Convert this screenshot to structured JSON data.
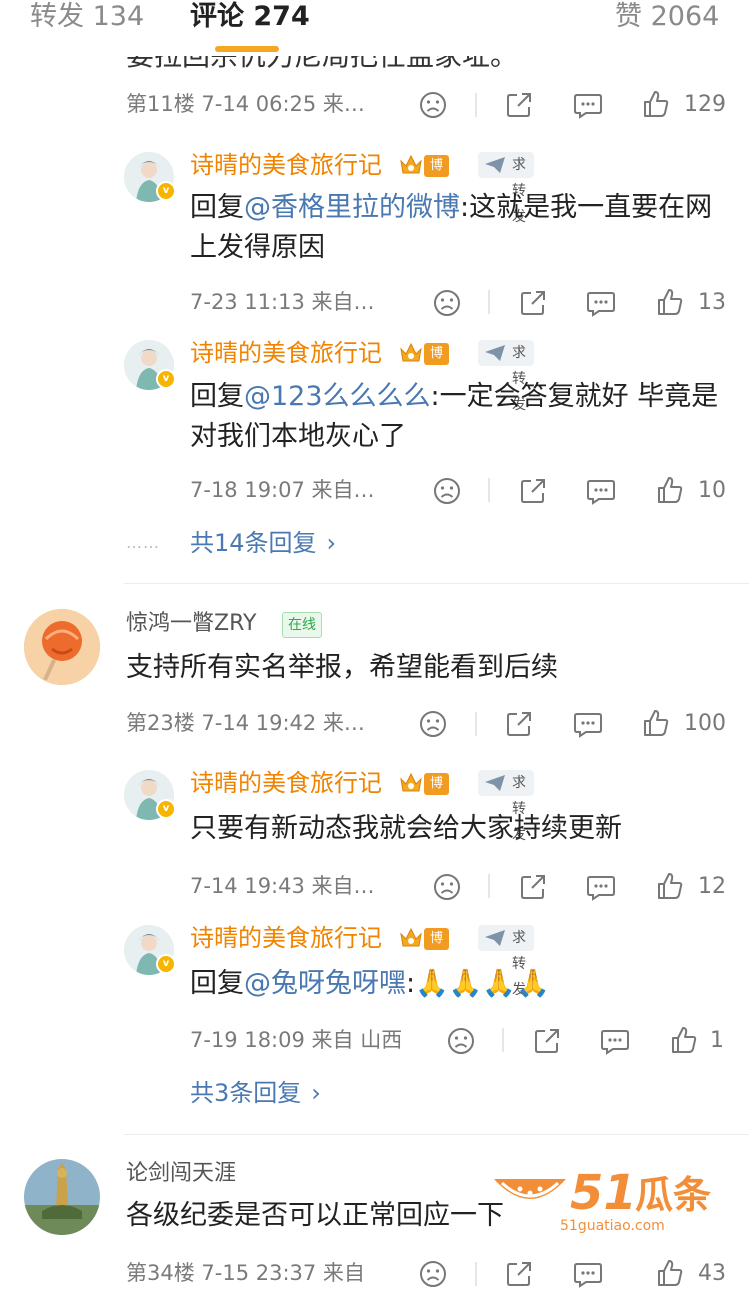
{
  "tabs": {
    "forward": "转发 134",
    "comments": "评论 274",
    "likes": "赞 2064"
  },
  "cut_text": "要拉回宗仇力尼局把任监家址。",
  "thread1": {
    "meta": "第11楼  7-14 06:25  来…",
    "likes": "129",
    "replies": [
      {
        "name": "诗晴的美食旅行记",
        "badge": "博主",
        "forward_tag": "求转发",
        "prefix": "回复",
        "mention": "@香格里拉的微博",
        "text": ":这就是我一直要在网上发得原因",
        "meta": "7-23 11:13  来自…",
        "likes": "13"
      },
      {
        "name": "诗晴的美食旅行记",
        "badge": "博主",
        "forward_tag": "求转发",
        "prefix": "回复",
        "mention": "@123么么么么",
        "text": ":一定会答复就好 毕竟是对我们本地灰心了",
        "meta": "7-18 19:07  来自…",
        "likes": "10"
      }
    ],
    "dots": "……",
    "more": "共14条回复"
  },
  "comment2": {
    "name": "惊鸿一瞥ZRY",
    "status": "在线",
    "text": "支持所有实名举报，希望能看到后续",
    "meta": "第23楼  7-14 19:42  来…",
    "likes": "100",
    "replies": [
      {
        "name": "诗晴的美食旅行记",
        "badge": "博主",
        "forward_tag": "求转发",
        "text": "只要有新动态我就会给大家持续更新",
        "meta": "7-14 19:43  来自…",
        "likes": "12"
      },
      {
        "name": "诗晴的美食旅行记",
        "badge": "博主",
        "forward_tag": "求转发",
        "prefix": "回复",
        "mention": "@兔呀兔呀嘿",
        "text": ":🙏🙏🙏🙏",
        "meta": "7-19 18:09  来自 山西",
        "likes": "1"
      }
    ],
    "more": "共3条回复"
  },
  "comment3": {
    "name": "论剑闯天涯",
    "text": "各级纪委是否可以正常回应一下",
    "meta": "第34楼  7-15 23:37  来自",
    "likes": "43"
  },
  "watermark": {
    "num": "51",
    "cn": "瓜条",
    "url": "51guatiao.com"
  },
  "icons": {
    "frown": "frown-icon",
    "share": "share-icon",
    "comment": "comment-icon",
    "like": "thumbs-up-icon"
  },
  "colors": {
    "accent": "#f5a623",
    "name_orange": "#f08300",
    "link_blue": "#4a78b0",
    "online_green": "#2da84a"
  }
}
